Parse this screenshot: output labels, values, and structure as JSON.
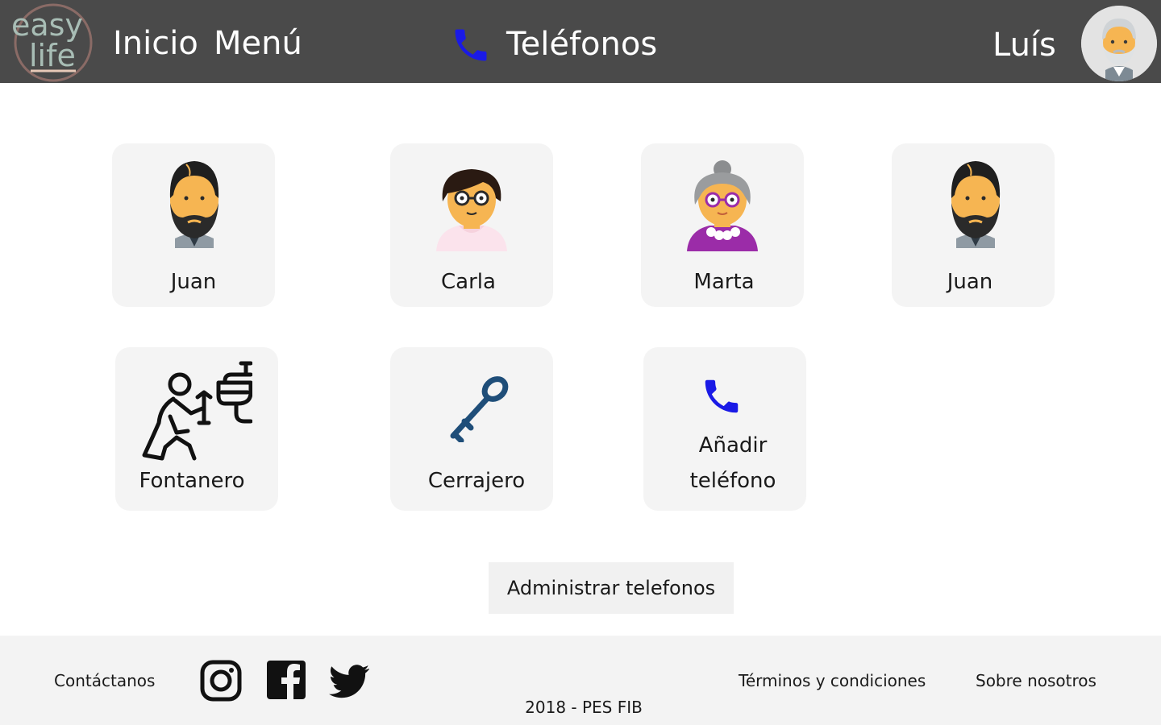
{
  "header": {
    "logo_text_top": "easy",
    "logo_text_bottom": "life",
    "nav": [
      {
        "label": "Inicio"
      },
      {
        "label": "Menú"
      }
    ],
    "page_title": "Teléfonos",
    "page_title_icon": "phone-icon",
    "user_name": "Luís",
    "user_avatar_icon": "elderly-man-avatar"
  },
  "contacts": [
    {
      "name": "Juan",
      "icon": "bearded-man-avatar"
    },
    {
      "name": "Carla",
      "icon": "woman-glasses-avatar"
    },
    {
      "name": "Marta",
      "icon": "grandmother-avatar"
    },
    {
      "name": "Juan",
      "icon": "bearded-man-avatar"
    },
    {
      "name": "Fontanero",
      "icon": "plumber-icon"
    },
    {
      "name": "Cerrajero",
      "icon": "key-icon"
    }
  ],
  "add_phone": {
    "label_line1": "Añadir",
    "label_line2": "teléfono",
    "icon": "phone-icon"
  },
  "admin_button": "Administrar telefonos",
  "footer": {
    "contact": "Contáctanos",
    "social": [
      "instagram-icon",
      "facebook-icon",
      "twitter-icon"
    ],
    "terms": "Términos y condiciones",
    "about": "Sobre nosotros",
    "copyright": "2018 - PES FIB"
  },
  "colors": {
    "header_bg": "#4a4a4a",
    "accent_phone": "#1a1ae6",
    "card_bg": "#f4f4f4",
    "footer_bg": "#f3f3f3"
  }
}
